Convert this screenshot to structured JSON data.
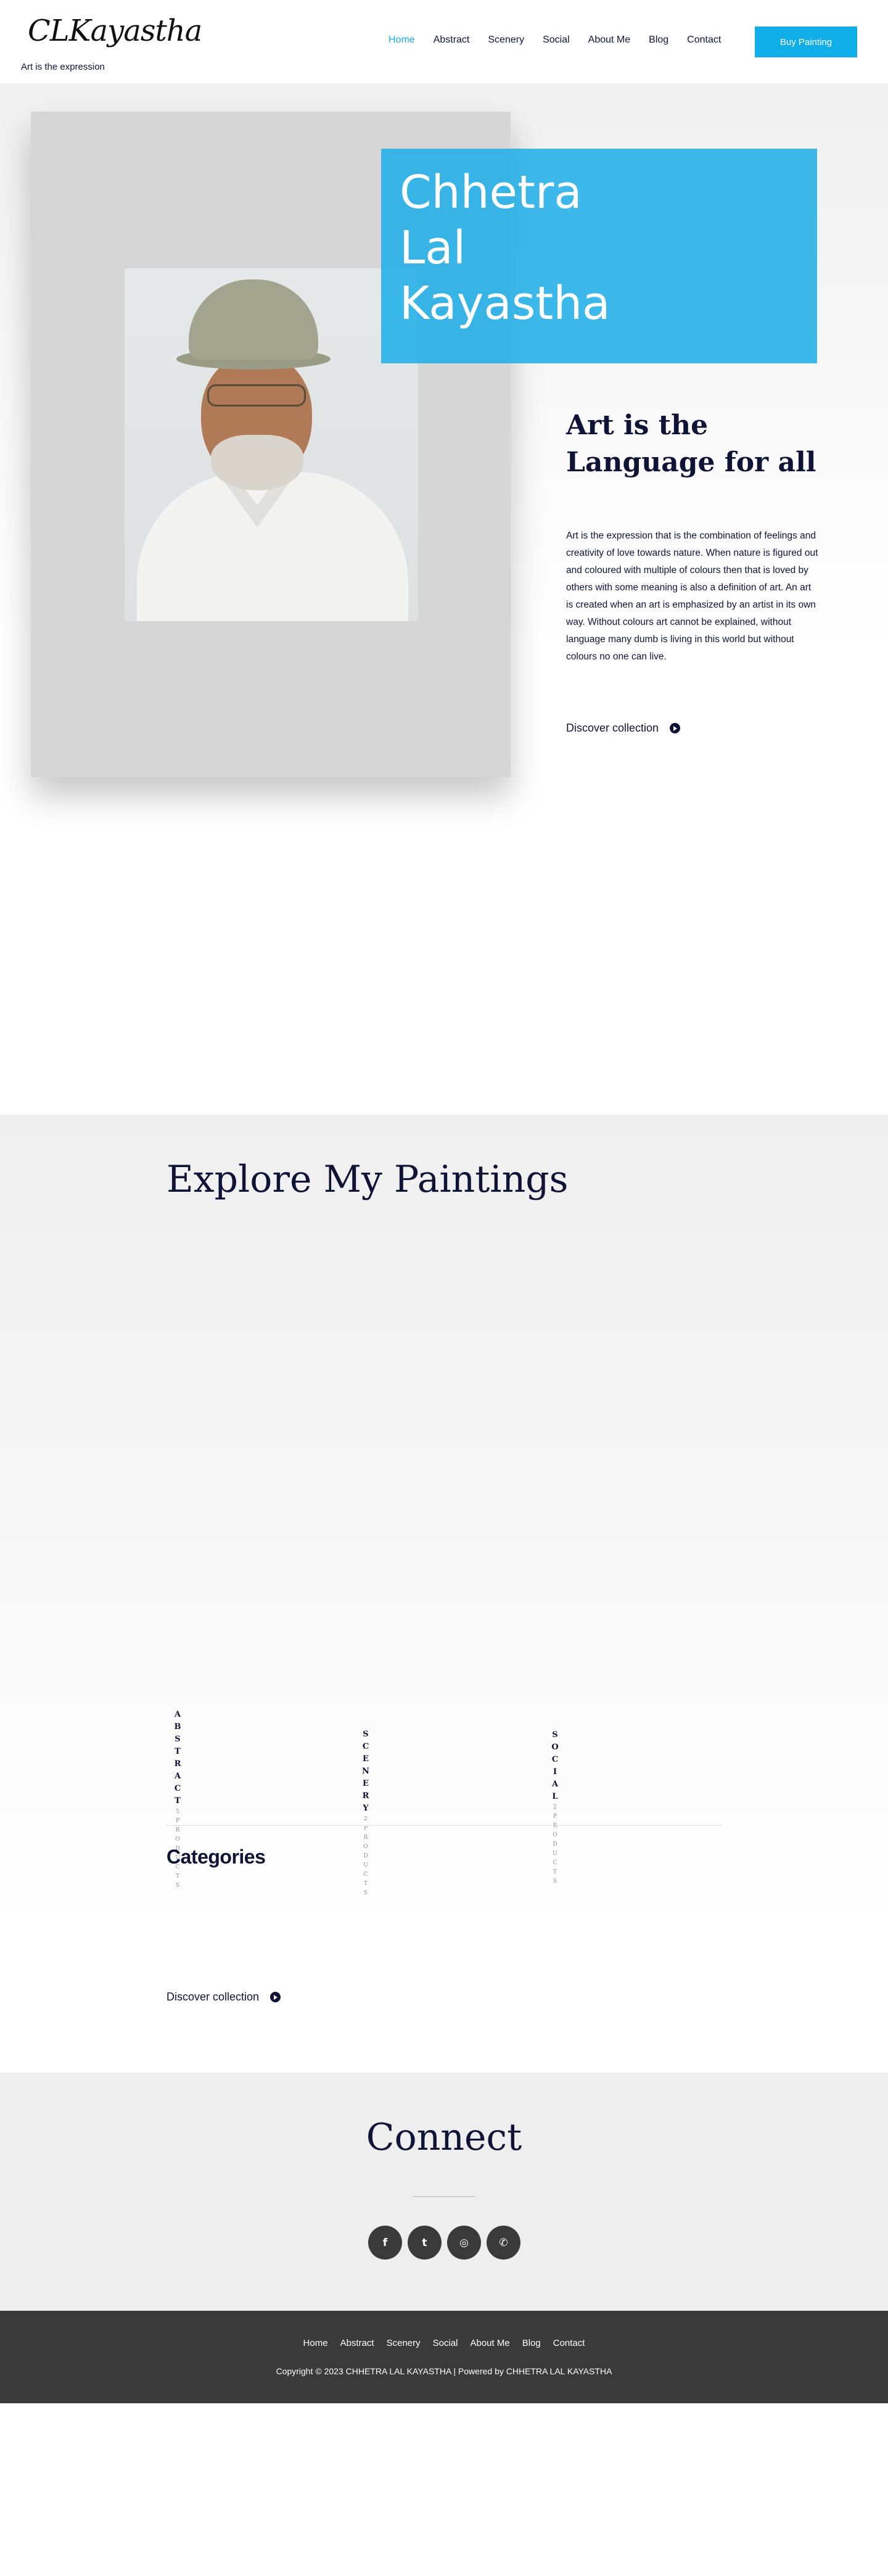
{
  "header": {
    "logo": "CLKayastha",
    "tagline": "Art is the expression",
    "nav": [
      "Home",
      "Abstract",
      "Scenery",
      "Social",
      "About Me",
      "Blog",
      "Contact"
    ],
    "cta": "Buy Painting",
    "accent_color": "#10aee8"
  },
  "hero": {
    "name_lines": [
      "Chhetra",
      "Lal",
      "Kayastha"
    ],
    "subheading": "Art is the Language for all",
    "description": "Art is the expression that is the combination of feelings and creativity of love towards nature. When nature is figured out and coloured with multiple of colours then that is loved by others with some meaning is also a definition of art. An art is created when an art is emphasized by an artist in its own way. Without colours art cannot be explained, without language many dumb is living in this world but without colours no one can live.",
    "discover": "Discover collection"
  },
  "explore": {
    "title": "Explore My Paintings",
    "categories": [
      {
        "name": "ABSTRACT",
        "count": "5 PRODUCTS"
      },
      {
        "name": "SCENERY",
        "count": "2 PRODUCTS"
      },
      {
        "name": "SOCIAL",
        "count": "2 PRODUCTS"
      }
    ],
    "categories_label": "Categories",
    "discover": "Discover collection"
  },
  "connect": {
    "title": "Connect",
    "socials": [
      {
        "icon": "facebook-icon",
        "glyph": "f"
      },
      {
        "icon": "twitter-icon",
        "glyph": "t"
      },
      {
        "icon": "instagram-icon",
        "glyph": "◎"
      },
      {
        "icon": "whatsapp-icon",
        "glyph": "✆"
      }
    ]
  },
  "footer": {
    "nav": [
      "Home",
      "Abstract",
      "Scenery",
      "Social",
      "About Me",
      "Blog",
      "Contact"
    ],
    "copyright": "Copyright © 2023 CHHETRA LAL KAYASTHA | Powered by CHHETRA LAL KAYASTHA"
  }
}
